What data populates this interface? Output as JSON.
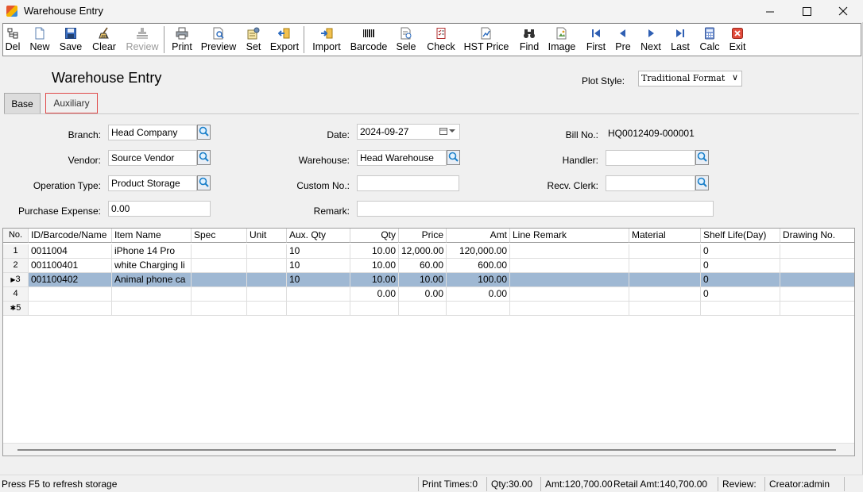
{
  "window": {
    "title": "Warehouse Entry"
  },
  "toolbar": [
    {
      "label": "Del",
      "icon": "delete-icon",
      "enabled": true
    },
    {
      "label": "New",
      "icon": "new-document-icon",
      "enabled": true
    },
    {
      "label": "Save",
      "icon": "save-icon",
      "enabled": true
    },
    {
      "label": "Clear",
      "icon": "broom-icon",
      "enabled": true
    },
    {
      "label": "Review",
      "icon": "stamp-icon",
      "enabled": false
    },
    {
      "label": "Print",
      "icon": "printer-icon",
      "enabled": true
    },
    {
      "label": "Preview",
      "icon": "preview-icon",
      "enabled": true
    },
    {
      "label": "Set",
      "icon": "settings-icon",
      "enabled": true
    },
    {
      "label": "Export",
      "icon": "export-icon",
      "enabled": true
    },
    {
      "label": "Import",
      "icon": "import-icon",
      "enabled": true
    },
    {
      "label": "Barcode",
      "icon": "barcode-icon",
      "enabled": true
    },
    {
      "label": "Sele",
      "icon": "select-icon",
      "enabled": true
    },
    {
      "label": "Check",
      "icon": "checklist-icon",
      "enabled": true
    },
    {
      "label": "HST Price",
      "icon": "price-history-icon",
      "enabled": true
    },
    {
      "label": "Find",
      "icon": "binoculars-icon",
      "enabled": true
    },
    {
      "label": "Image",
      "icon": "image-icon",
      "enabled": true
    },
    {
      "label": "First",
      "icon": "first-icon",
      "enabled": true
    },
    {
      "label": "Pre",
      "icon": "previous-icon",
      "enabled": true
    },
    {
      "label": "Next",
      "icon": "next-icon",
      "enabled": true
    },
    {
      "label": "Last",
      "icon": "last-icon",
      "enabled": true
    },
    {
      "label": "Calc",
      "icon": "calculator-icon",
      "enabled": true
    },
    {
      "label": "Exit",
      "icon": "exit-icon",
      "enabled": true
    }
  ],
  "header": {
    "title": "Warehouse Entry",
    "plot_style_label": "Plot Style:",
    "plot_style_value": "Traditional Format"
  },
  "tabs": [
    {
      "label": "Base",
      "active": true
    },
    {
      "label": "Auxiliary",
      "active": false
    }
  ],
  "form": {
    "branch": {
      "label": "Branch:",
      "value": "Head Company"
    },
    "vendor": {
      "label": "Vendor:",
      "value": "Source Vendor"
    },
    "operation_type": {
      "label": "Operation Type:",
      "value": "Product Storage"
    },
    "purchase_expense": {
      "label": "Purchase Expense:",
      "value": "0.00"
    },
    "date": {
      "label": "Date:",
      "value": "2024-09-27"
    },
    "warehouse": {
      "label": "Warehouse:",
      "value": "Head Warehouse"
    },
    "custom_no": {
      "label": "Custom No.:",
      "value": ""
    },
    "remark": {
      "label": "Remark:",
      "value": ""
    },
    "bill_no": {
      "label": "Bill No.:",
      "value": "HQ0012409-000001"
    },
    "handler": {
      "label": "Handler:",
      "value": ""
    },
    "recv_clerk": {
      "label": "Recv. Clerk:",
      "value": ""
    }
  },
  "grid": {
    "columns": [
      "No.",
      "ID/Barcode/Name",
      "Item Name",
      "Spec",
      "Unit",
      "Aux. Qty",
      "Qty",
      "Price",
      "Amt",
      "Line Remark",
      "Material",
      "Shelf Life(Day)",
      "Drawing No."
    ],
    "rows": [
      {
        "no": "1",
        "id": "0011004",
        "name": "iPhone 14 Pro",
        "spec": "",
        "unit": "",
        "aux_qty": "10",
        "qty": "10.00",
        "price": "12,000.00",
        "amt": "120,000.00",
        "line_remark": "",
        "material": "",
        "shelf_life": "0",
        "drawing_no": "",
        "selected": false
      },
      {
        "no": "2",
        "id": "001100401",
        "name": "white Charging li",
        "spec": "",
        "unit": "",
        "aux_qty": "10",
        "qty": "10.00",
        "price": "60.00",
        "amt": "600.00",
        "line_remark": "",
        "material": "",
        "shelf_life": "0",
        "drawing_no": "",
        "selected": false
      },
      {
        "no": "3",
        "id": "001100402",
        "name": "Animal phone ca",
        "spec": "",
        "unit": "",
        "aux_qty": "10",
        "qty": "10.00",
        "price": "10.00",
        "amt": "100.00",
        "line_remark": "",
        "material": "",
        "shelf_life": "0",
        "drawing_no": "",
        "selected": true
      },
      {
        "no": "4",
        "id": "",
        "name": "",
        "spec": "",
        "unit": "",
        "aux_qty": "",
        "qty": "0.00",
        "price": "0.00",
        "amt": "0.00",
        "line_remark": "",
        "material": "",
        "shelf_life": "0",
        "drawing_no": "",
        "selected": false
      },
      {
        "no": "5",
        "id": "",
        "name": "",
        "spec": "",
        "unit": "",
        "aux_qty": "",
        "qty": "",
        "price": "",
        "amt": "",
        "line_remark": "",
        "material": "",
        "shelf_life": "",
        "drawing_no": "",
        "selected": false
      }
    ]
  },
  "status": {
    "hint": "Press F5 to refresh storage",
    "print_times": "Print Times:0",
    "qty": "Qty:30.00",
    "amt": "Amt:120,700.00",
    "retail_amt": "Retail Amt:140,700.00",
    "review": "Review:",
    "creator": "Creator:admin"
  },
  "colors": {
    "selected_row": "#9fb8d3",
    "lookup_icon": "#1a7fc9",
    "tab_highlight": "#e04a4a"
  }
}
